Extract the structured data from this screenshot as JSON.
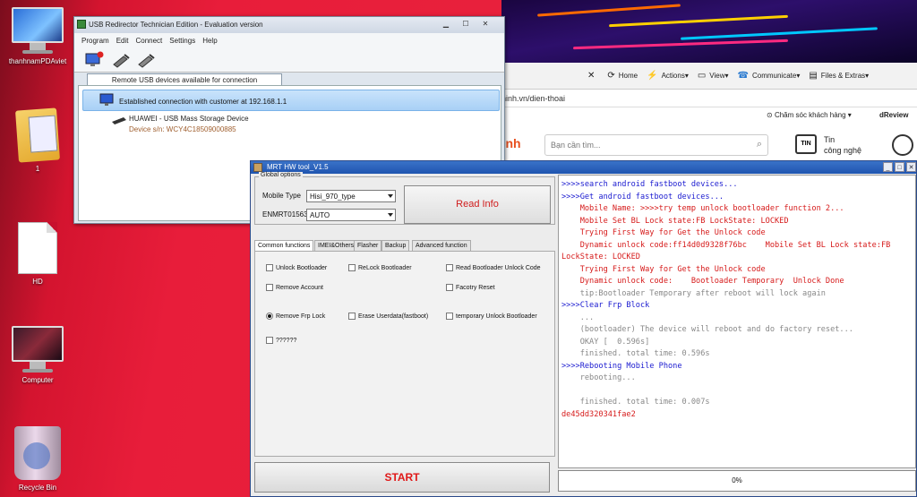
{
  "desktop": {
    "icons": [
      {
        "label": "thanhnamPDAviet"
      },
      {
        "label": "1"
      },
      {
        "label": "HD"
      },
      {
        "label": "Computer"
      },
      {
        "label": "Recycle Bin"
      }
    ]
  },
  "browser": {
    "toolbar": {
      "home": "Home",
      "actions": "Actions",
      "view": "View",
      "communicate": "Communicate",
      "files": "Files & Extras"
    },
    "url_fragment": "hinh.vn/dien-thoai",
    "support": "Chăm sóc khách hàng",
    "review": "dReview",
    "logo_fragment": "hinh",
    "search_placeholder": "Bạn cần tìm...",
    "news_line1": "Tin",
    "news_line2": "công nghệ"
  },
  "usb": {
    "title": "USB Redirector Technician Edition - Evaluation version",
    "menu": [
      "Program",
      "Edit",
      "Connect",
      "Settings",
      "Help"
    ],
    "tab": "Remote USB devices available for connection",
    "connection": "Established connection with customer at 192.168.1.1",
    "device": "HUAWEI - USB Mass Storage Device",
    "serial": "Device s/n: WCY4C18509000885"
  },
  "mrt": {
    "title": "MRT HW tool_V1.5",
    "global_options": "Global options",
    "mobile_type_label": "Mobile Type",
    "mobile_type_value": "Hisi_970_type",
    "enmrt_label": "ENMRT01563",
    "enmrt_value": "AUTO",
    "read_info": "Read Info",
    "tabs": [
      "Common functions",
      "IMEI&Others",
      "Flasher",
      "Backup",
      "Advanced function"
    ],
    "options": {
      "unlock_bootloader": "Unlock Bootloader",
      "relock_bootloader": "ReLock Bootloader",
      "read_bootloader_unlock_code": "Read Bootloader Unlock Code",
      "remove_account": "Remove Account",
      "factory_reset": "Facotry Reset",
      "remove_frp": "Remove Frp Lock",
      "erase_userdata": "Erase Userdata(fastboot)",
      "temporary_unlock": "temporary Unlock Bootloader",
      "unknown": "??????"
    },
    "start": "START",
    "progress_text": "0%",
    "log": [
      {
        "text": ">>>>search android fastboot devices...",
        "color": "blue"
      },
      {
        "text": ">>>>Get android fastboot devices...",
        "color": "blue"
      },
      {
        "text": "    Mobile Name: >>>>try temp unlock bootloader function 2...",
        "color": "red"
      },
      {
        "text": "    Mobile Set BL Lock state:FB LockState: LOCKED",
        "color": "red"
      },
      {
        "text": "    Trying First Way for Get the Unlock code",
        "color": "red"
      },
      {
        "text": "    Dynamic unlock code:ff14d0d9328f76bc    Mobile Set BL Lock state:FB",
        "color": "red"
      },
      {
        "text": "LockState: LOCKED",
        "color": "red"
      },
      {
        "text": "    Trying First Way for Get the Unlock code",
        "color": "red"
      },
      {
        "text": "    Dynamic unlock code:    Bootloader Temporary  Unlock Done",
        "color": "red"
      },
      {
        "text": "    tip:Bootloader Temporary after reboot will lock again",
        "color": "gray"
      },
      {
        "text": ">>>>Clear Frp Block",
        "color": "blue"
      },
      {
        "text": "    ...",
        "color": "gray"
      },
      {
        "text": "    (bootloader) The device will reboot and do factory reset...",
        "color": "gray"
      },
      {
        "text": "    OKAY [  0.596s]",
        "color": "gray"
      },
      {
        "text": "    finished. total time: 0.596s",
        "color": "gray"
      },
      {
        "text": ">>>>Rebooting Mobile Phone",
        "color": "blue"
      },
      {
        "text": "    rebooting...",
        "color": "gray"
      },
      {
        "text": "",
        "color": "gray"
      },
      {
        "text": "    finished. total time: 0.007s",
        "color": "gray"
      },
      {
        "text": "de45dd320341fae2",
        "color": "red"
      }
    ]
  }
}
